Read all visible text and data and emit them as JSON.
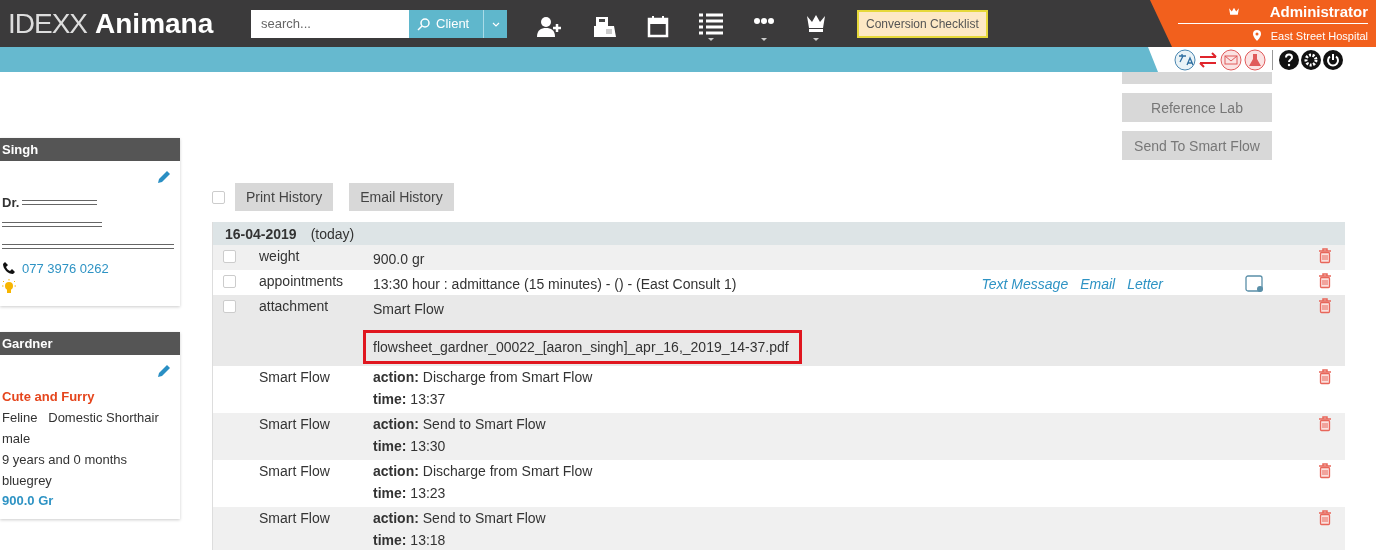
{
  "header": {
    "logo_light": "IDEXX",
    "logo_bold": "Animana",
    "search": {
      "placeholder": "search..."
    },
    "search_button": "Client",
    "checklist_button": "Conversion Checklist",
    "user": "Administrator",
    "location": "East Street Hospital"
  },
  "client_card": {
    "title": "Singh",
    "name_prefix": "Dr.",
    "phone": "077 3976 0262"
  },
  "patient_card": {
    "title": "Gardner",
    "alert": "Cute and Furry",
    "lines": [
      "Feline   Domestic Shorthair",
      "male",
      "9 years and 0 months",
      "bluegrey"
    ],
    "weight": "900.0 Gr"
  },
  "side_buttons": [
    "Reference Lab",
    "Send To Smart Flow"
  ],
  "history": {
    "buttons": [
      "Print History",
      "Email History"
    ],
    "select_all_checked": false,
    "date": "16-04-2019",
    "date_note": "(today)",
    "entries": [
      {
        "kind": "item",
        "checked": false,
        "label": "weight",
        "value": "900.0 gr"
      },
      {
        "kind": "item",
        "checked": false,
        "label": "appointments",
        "value": "13:30 hour : admittance (15 minutes) - () - (East Consult 1)",
        "links": [
          "Text Message",
          "Email",
          "Letter"
        ]
      },
      {
        "kind": "file",
        "checked": false,
        "label": "attachment",
        "value": "Smart Flow",
        "file": "flowsheet_gardner_00022_[aaron_singh]_apr_16,_2019_14-37.pdf"
      },
      {
        "kind": "flow",
        "label": "Smart Flow",
        "action": "**action:** Discharge from Smart Flow",
        "time": "**time:** 13:37"
      },
      {
        "kind": "flow",
        "label": "Smart Flow",
        "action": "**action:** Send to Smart Flow",
        "time": "**time:** 13:30"
      },
      {
        "kind": "flow",
        "label": "Smart Flow",
        "action": "**action:** Discharge from Smart Flow",
        "time": "**time:** 13:23"
      },
      {
        "kind": "flow",
        "label": "Smart Flow",
        "action": "**action:** Send to Smart Flow",
        "time": "**time:** 13:18"
      }
    ]
  }
}
